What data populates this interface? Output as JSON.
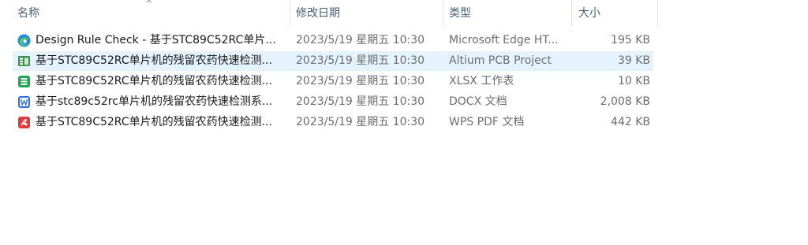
{
  "header": {
    "name": "名称",
    "date": "修改日期",
    "type": "类型",
    "size": "大小",
    "sort_indicator": "^"
  },
  "files": [
    {
      "icon": "edge-icon",
      "name": "Design Rule Check - 基于STC89C52RC单片...",
      "date": "2023/5/19 星期五 10:30",
      "type": "Microsoft Edge HT...",
      "size": "195 KB",
      "selected": false
    },
    {
      "icon": "altium-icon",
      "name": "基于STC89C52RC单片机的残留农药快速检测...",
      "date": "2023/5/19 星期五 10:30",
      "type": "Altium PCB Project",
      "size": "39 KB",
      "selected": true
    },
    {
      "icon": "xlsx-icon",
      "name": "基于STC89C52RC单片机的残留农药快速检测...",
      "date": "2023/5/19 星期五 10:30",
      "type": "XLSX 工作表",
      "size": "10 KB",
      "selected": false
    },
    {
      "icon": "docx-icon",
      "name": "基于stc89c52rc单片机的残留农药快速检测系...",
      "date": "2023/5/19 星期五 10:30",
      "type": "DOCX 文档",
      "size": "2,008 KB",
      "selected": false
    },
    {
      "icon": "pdf-icon",
      "name": "基于STC89C52RC单片机的残留农药快速检测...",
      "date": "2023/5/19 星期五 10:30",
      "type": "WPS PDF 文档",
      "size": "442 KB",
      "selected": false
    }
  ],
  "colors": {
    "header_text": "#4c607a",
    "selected_row": "#e5f3ff",
    "secondary_text": "#6d6d6d",
    "edge": "#1f8fd8",
    "altium": "#3a8f4a",
    "xlsx": "#1fa84f",
    "docx": "#2f6fe0",
    "pdf": "#e03a3a"
  }
}
